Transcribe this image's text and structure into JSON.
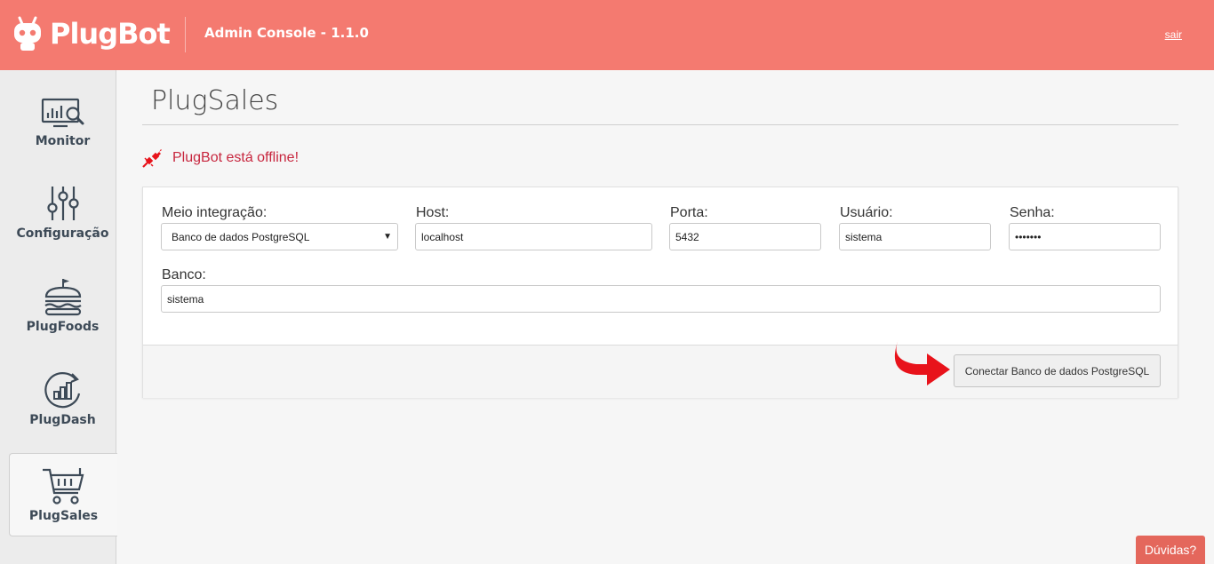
{
  "header": {
    "brand": "PlugBot",
    "title": "Admin Console - 1.1.0",
    "logout": "sair"
  },
  "sidebar": {
    "items": [
      {
        "label": "Monitor",
        "icon": "monitor-search-icon",
        "active": false
      },
      {
        "label": "Configuração",
        "icon": "sliders-icon",
        "active": false
      },
      {
        "label": "PlugFoods",
        "icon": "burger-icon",
        "active": false
      },
      {
        "label": "PlugDash",
        "icon": "chart-refresh-icon",
        "active": false
      },
      {
        "label": "PlugSales",
        "icon": "cart-icon",
        "active": true
      }
    ]
  },
  "main": {
    "title": "PlugSales",
    "status": "PlugBot está offline!",
    "form": {
      "integration_label": "Meio integração:",
      "integration_value": "Banco de dados PostgreSQL",
      "host_label": "Host:",
      "host_value": "localhost",
      "port_label": "Porta:",
      "port_value": "5432",
      "user_label": "Usuário:",
      "user_value": "sistema",
      "password_label": "Senha:",
      "password_value": "•••••••",
      "database_label": "Banco:",
      "database_value": "sistema"
    },
    "connect_button": "Conectar Banco de dados PostgreSQL"
  },
  "help_button": "Dúvidas?",
  "colors": {
    "header": "#f47a70",
    "status": "#c7263e",
    "arrow": "#e8131b"
  }
}
